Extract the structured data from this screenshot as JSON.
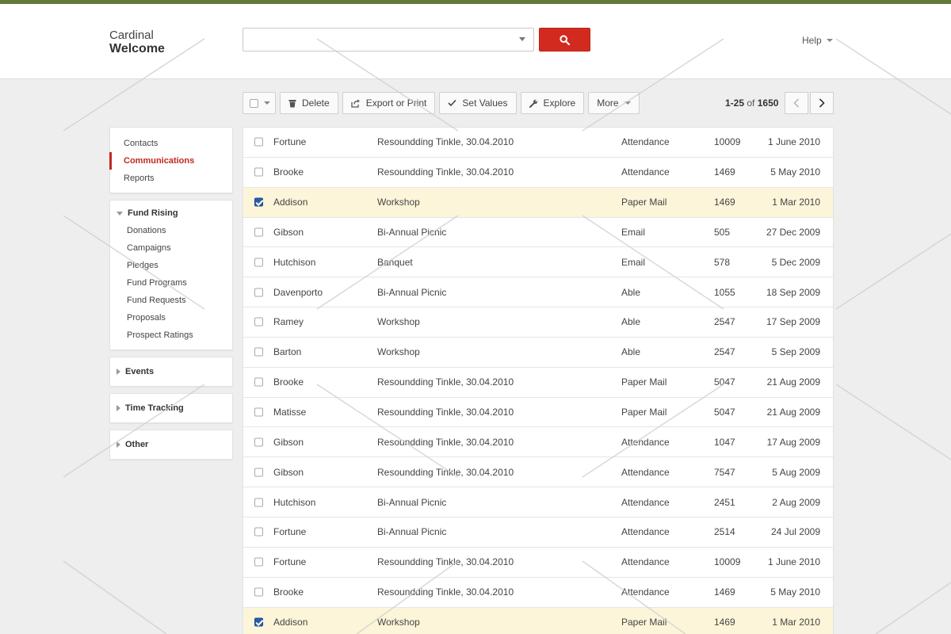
{
  "brand": {
    "top": "Cardinal",
    "bottom": "Welcome"
  },
  "search": {
    "value": "",
    "placeholder": ""
  },
  "help": {
    "label": "Help"
  },
  "toolbar": {
    "delete": "Delete",
    "export": "Export or Print",
    "set_values": "Set Values",
    "explore": "Explore",
    "more": "More"
  },
  "pager": {
    "range": "1-25",
    "of": "of",
    "total": "1650"
  },
  "sidebar": {
    "nav": [
      {
        "label": "Contacts",
        "active": false
      },
      {
        "label": "Communications",
        "active": true
      },
      {
        "label": "Reports",
        "active": false
      }
    ],
    "fund_group": {
      "label": "Fund Rising",
      "items": [
        "Donations",
        "Campaigns",
        "Pledges",
        "Fund Programs",
        "Fund Requests",
        "Proposals",
        "Prospect Ratings"
      ]
    },
    "collapsed_groups": [
      "Events",
      "Time Tracking",
      "Other"
    ]
  },
  "rows": [
    {
      "name": "Fortune",
      "event": "Resoundding Tinkle, 30.04.2010",
      "type": "Attendance",
      "num": "10009",
      "date": "1 June 2010",
      "checked": false
    },
    {
      "name": "Brooke",
      "event": "Resoundding Tinkle, 30.04.2010",
      "type": "Attendance",
      "num": "1469",
      "date": "5 May 2010",
      "checked": false
    },
    {
      "name": "Addison",
      "event": "Workshop",
      "type": "Paper Mail",
      "num": "1469",
      "date": "1 Mar 2010",
      "checked": true
    },
    {
      "name": "Gibson",
      "event": "Bi-Annual Picnic",
      "type": "Email",
      "num": "505",
      "date": "27 Dec 2009",
      "checked": false
    },
    {
      "name": "Hutchison",
      "event": "Banquet",
      "type": "Email",
      "num": "578",
      "date": "5 Dec 2009",
      "checked": false
    },
    {
      "name": "Davenporto",
      "event": "Bi-Annual Picnic",
      "type": "Able",
      "num": "1055",
      "date": "18 Sep 2009",
      "checked": false
    },
    {
      "name": "Ramey",
      "event": "Workshop",
      "type": "Able",
      "num": "2547",
      "date": "17 Sep 2009",
      "checked": false
    },
    {
      "name": "Barton",
      "event": "Workshop",
      "type": "Able",
      "num": "2547",
      "date": "5 Sep 2009",
      "checked": false
    },
    {
      "name": "Brooke",
      "event": "Resoundding Tinkle, 30.04.2010",
      "type": "Paper Mail",
      "num": "5047",
      "date": "21 Aug 2009",
      "checked": false
    },
    {
      "name": "Matisse",
      "event": "Resoundding Tinkle, 30.04.2010",
      "type": "Paper Mail",
      "num": "5047",
      "date": "21 Aug 2009",
      "checked": false
    },
    {
      "name": "Gibson",
      "event": "Resoundding Tinkle, 30.04.2010",
      "type": "Attendance",
      "num": "1047",
      "date": "17 Aug 2009",
      "checked": false
    },
    {
      "name": "Gibson",
      "event": "Resoundding Tinkle, 30.04.2010",
      "type": "Attendance",
      "num": "7547",
      "date": "5 Aug 2009",
      "checked": false
    },
    {
      "name": "Hutchison",
      "event": "Bi-Annual Picnic",
      "type": "Attendance",
      "num": "2451",
      "date": "2 Aug 2009",
      "checked": false
    },
    {
      "name": "Fortune",
      "event": "Bi-Annual Picnic",
      "type": "Attendance",
      "num": "2514",
      "date": "24 Jul 2009",
      "checked": false
    },
    {
      "name": "Fortune",
      "event": "Resoundding Tinkle, 30.04.2010",
      "type": "Attendance",
      "num": "10009",
      "date": "1 June 2010",
      "checked": false
    },
    {
      "name": "Brooke",
      "event": "Resoundding Tinkle, 30.04.2010",
      "type": "Attendance",
      "num": "1469",
      "date": "5 May 2010",
      "checked": false
    },
    {
      "name": "Addison",
      "event": "Workshop",
      "type": "Paper Mail",
      "num": "1469",
      "date": "1 Mar 2010",
      "checked": true
    }
  ],
  "colors": {
    "accent": "#d32a1f",
    "topstripe": "#5f7a3a",
    "selected_row": "#fdf5d9",
    "checkbox_checked": "#2a5da8"
  },
  "icons": {
    "search_button": "search-icon",
    "delete": "trash-icon",
    "export": "export-icon",
    "set_values": "checkmark-icon",
    "explore": "wrench-icon",
    "prev": "chevron-left-icon",
    "next": "chevron-right-icon"
  }
}
